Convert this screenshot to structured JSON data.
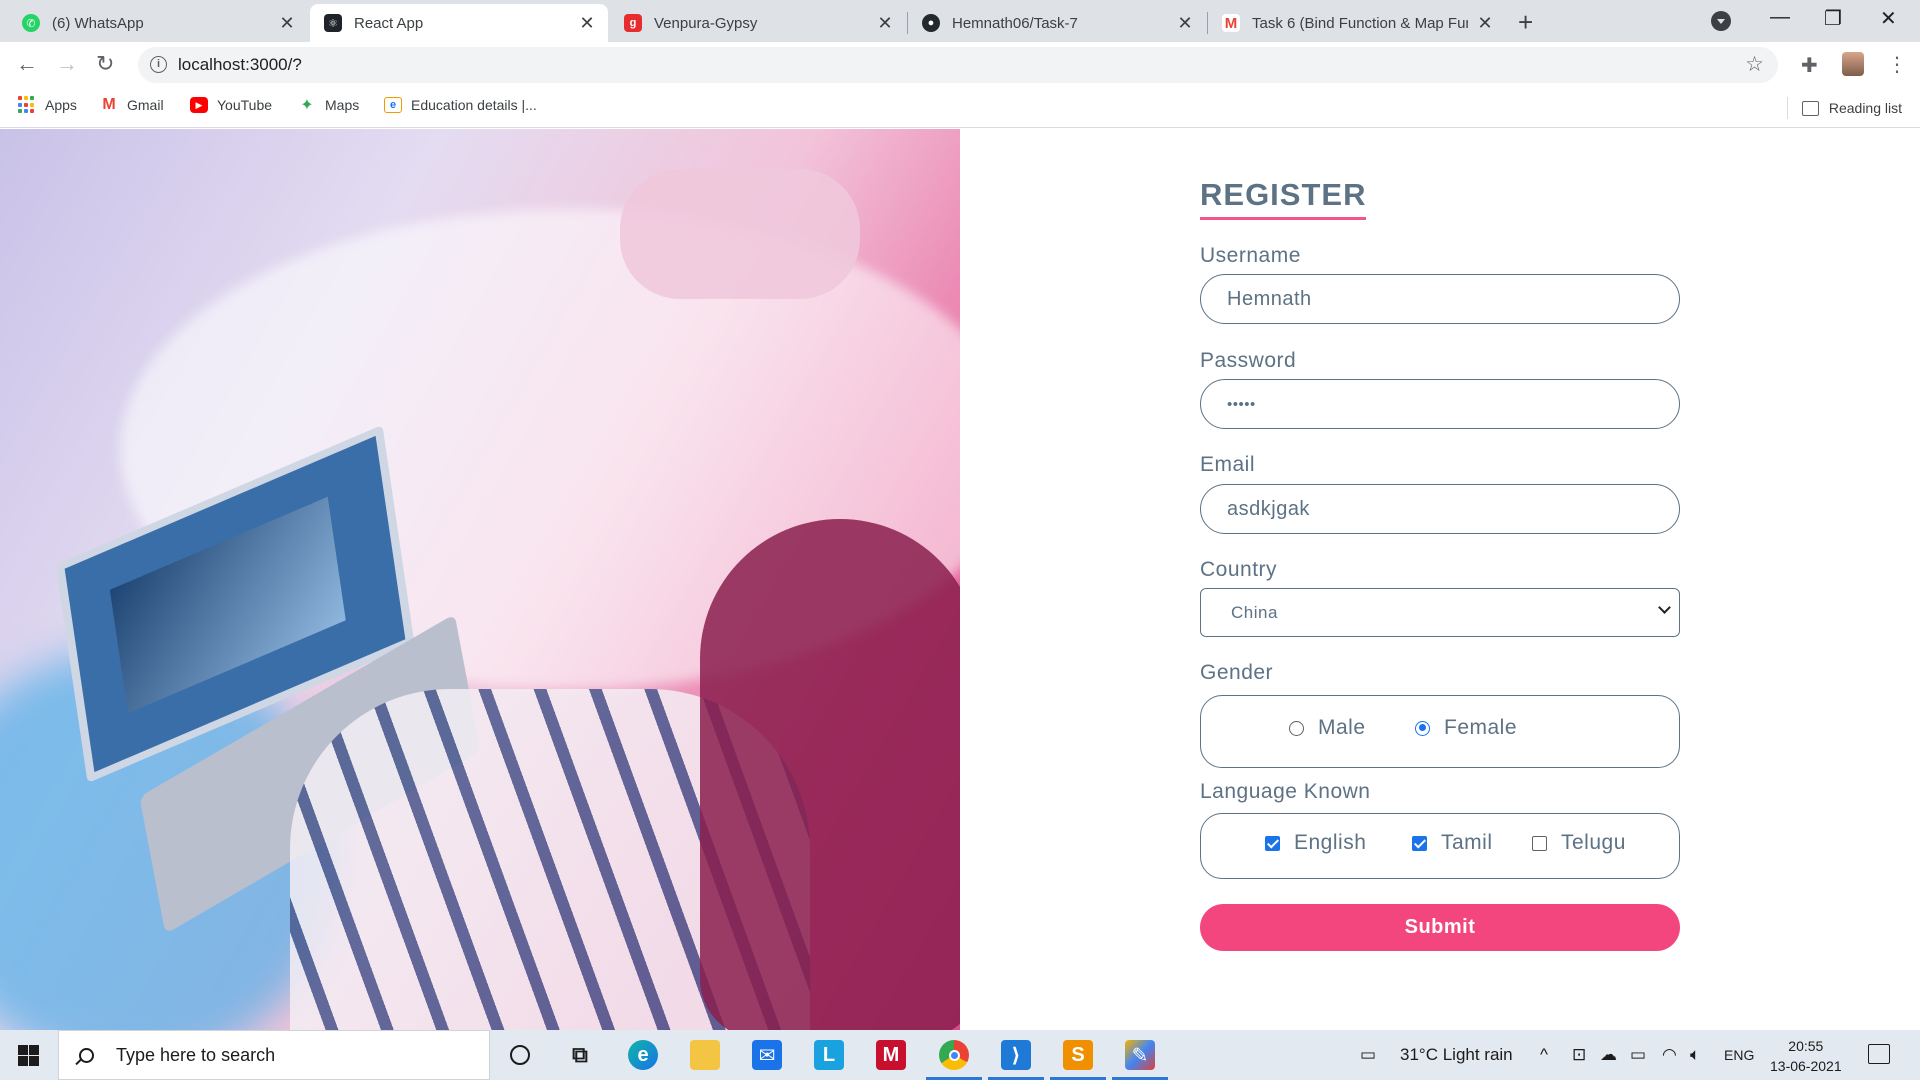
{
  "browser": {
    "tabs": [
      {
        "title": "(6) WhatsApp",
        "icon": "whatsapp-icon",
        "color": "#25d366",
        "active": false
      },
      {
        "title": "React App",
        "icon": "react-icon",
        "color": "#20232a",
        "active": true
      },
      {
        "title": "Venpura-Gypsy",
        "icon": "gaana-icon",
        "color": "#e72c30",
        "active": false
      },
      {
        "title": "Hemnath06/Task-7",
        "icon": "github-icon",
        "color": "#24292e",
        "active": false
      },
      {
        "title": "Task 6 (Bind Function & Map Fun",
        "icon": "gmail-icon",
        "color": "#ea4335",
        "active": false
      }
    ],
    "url": "localhost:3000/?",
    "bookmarks": [
      {
        "label": "Apps",
        "icon": "apps-grid-icon"
      },
      {
        "label": "Gmail",
        "icon": "gmail-icon"
      },
      {
        "label": "YouTube",
        "icon": "youtube-icon"
      },
      {
        "label": "Maps",
        "icon": "maps-icon"
      },
      {
        "label": "Education details |...",
        "icon": "education-icon"
      }
    ],
    "reading_list": "Reading list"
  },
  "form": {
    "heading": "REGISTER",
    "username": {
      "label": "Username",
      "value": "Hemnath"
    },
    "password": {
      "label": "Password",
      "value": "•••••"
    },
    "email": {
      "label": "Email",
      "value": "asdkjgak"
    },
    "country": {
      "label": "Country",
      "value": "China"
    },
    "gender": {
      "label": "Gender",
      "options": [
        {
          "label": "Male",
          "checked": false
        },
        {
          "label": "Female",
          "checked": true
        }
      ]
    },
    "languages": {
      "label": "Language Known",
      "options": [
        {
          "label": "English",
          "checked": true
        },
        {
          "label": "Tamil",
          "checked": true
        },
        {
          "label": "Telugu",
          "checked": false
        }
      ]
    },
    "submit": "Submit"
  },
  "colors": {
    "accent": "#f3467f",
    "text": "#5d7284",
    "control_blue": "#1a73e8"
  },
  "taskbar": {
    "search_placeholder": "Type here to search",
    "apps": [
      "cortana-icon",
      "task-view-icon",
      "edge-icon",
      "file-explorer-icon",
      "mail-icon",
      "l-app-icon",
      "mcafee-icon",
      "chrome-icon",
      "vscode-icon",
      "sublime-icon",
      "paint-icon"
    ],
    "weather": "31°C  Light rain",
    "language": "ENG",
    "time": "20:55",
    "date": "13-06-2021"
  }
}
